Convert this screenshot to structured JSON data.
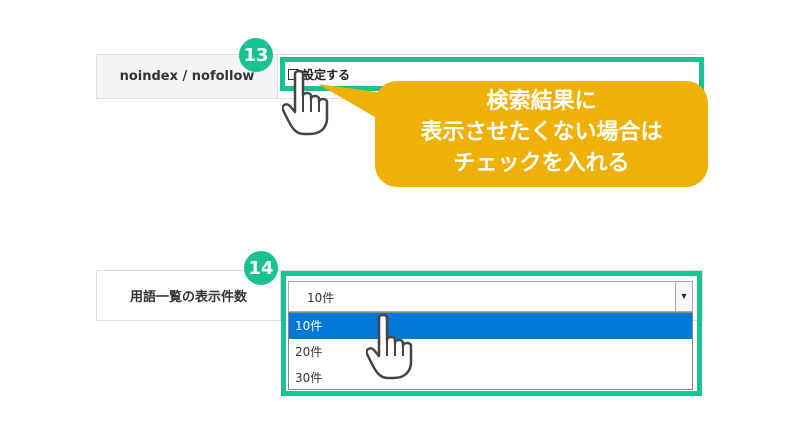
{
  "row1": {
    "badge": "13",
    "label": "noindex / nofollow",
    "checkbox_label": "設定する",
    "callout": [
      "検索結果に",
      "表示させたくない場合は",
      "チェックを入れる"
    ]
  },
  "row2": {
    "badge": "14",
    "label": "用語一覧の表示件数",
    "select_value": "10件",
    "options": [
      "10件",
      "20件",
      "30件"
    ],
    "selected_option": "10件"
  },
  "colors": {
    "highlight": "#19c290",
    "callout": "#f0b107",
    "dropdown_selected": "#0078d7"
  },
  "icons": {
    "pointer": "pointing-hand-icon",
    "dropdown": "chevron-down-icon"
  }
}
